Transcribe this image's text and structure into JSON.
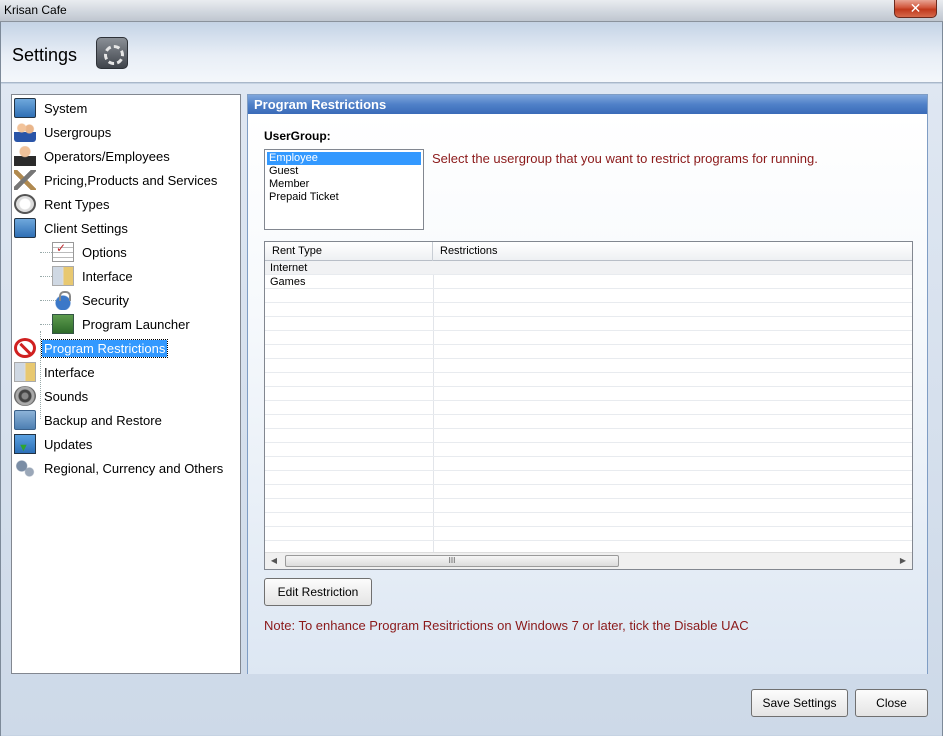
{
  "window": {
    "title": "Krisan Cafe",
    "close_glyph": "✕"
  },
  "header": {
    "title": "Settings",
    "icon": "settings-gear-icon"
  },
  "tree": {
    "items": [
      {
        "label": "System",
        "icon": "monitor-icon"
      },
      {
        "label": "Usergroups",
        "icon": "people-icon"
      },
      {
        "label": "Operators/Employees",
        "icon": "person-icon"
      },
      {
        "label": "Pricing,Products and Services",
        "icon": "tools-icon"
      },
      {
        "label": "Rent Types",
        "icon": "clock-icon"
      },
      {
        "label": "Client Settings",
        "icon": "monitor-icon"
      },
      {
        "label": "Options",
        "icon": "options-icon",
        "child": true
      },
      {
        "label": "Interface",
        "icon": "interface-icon",
        "child": true
      },
      {
        "label": "Security",
        "icon": "lock-icon",
        "child": true
      },
      {
        "label": "Program Launcher",
        "icon": "launcher-icon",
        "child": true
      },
      {
        "label": "Program Restrictions",
        "icon": "no-entry-icon",
        "selected": true
      },
      {
        "label": "Interface",
        "icon": "interface-icon"
      },
      {
        "label": "Sounds",
        "icon": "speaker-icon"
      },
      {
        "label": "Backup and Restore",
        "icon": "folder-icon"
      },
      {
        "label": "Updates",
        "icon": "updates-icon"
      },
      {
        "label": "Regional, Currency and Others",
        "icon": "gears-icon"
      }
    ]
  },
  "panel": {
    "title": "Program Restrictions",
    "usergroup_label": "UserGroup:",
    "usergroups": [
      "Employee",
      "Guest",
      "Member",
      "Prepaid Ticket"
    ],
    "selected_usergroup": "Employee",
    "hint": "Select the usergroup that you want to restrict programs for running.",
    "grid": {
      "columns": [
        "Rent Type",
        "Restrictions"
      ],
      "rows": [
        {
          "rent_type": "Internet",
          "restrictions": ""
        },
        {
          "rent_type": "Games",
          "restrictions": ""
        }
      ],
      "scroll_thumb": "III"
    },
    "edit_button": "Edit Restriction",
    "note": "Note: To enhance Program Resitrictions on Windows 7 or later, tick the Disable UAC"
  },
  "footer": {
    "save_button": "Save Settings",
    "close_button": "Close"
  }
}
